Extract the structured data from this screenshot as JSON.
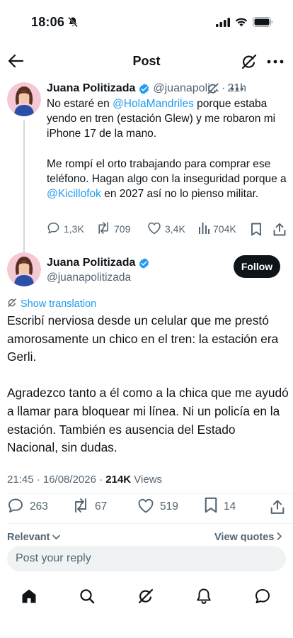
{
  "status_bar": {
    "time": "18:06",
    "icons": [
      "bell-slash-icon",
      "cellular-signal-icon",
      "wifi-icon",
      "battery-icon"
    ]
  },
  "header": {
    "title": "Post",
    "back_icon": "arrow-left-icon",
    "grok_icon": "grok-icon",
    "more_icon": "more-horizontal-icon"
  },
  "parent_tweet": {
    "author_name": "Juana Politizada",
    "handle": "@juanapoli...",
    "dot": "·",
    "time": "21h",
    "text_line1_a": "No estaré en ",
    "mention1": "@HolaMandriles",
    "text_line1_b": " porque estaba yendo en tren (estación Glew) y me robaron mi iPhone 17 de la mano.",
    "text_para2_a": "Me rompí el orto trabajando para comprar ese teléfono. Hagan algo con la inseguridad porque a ",
    "mention2": "@Kicillofok",
    "text_para2_b": " en 2027 así no lo pienso militar.",
    "replies": "1,3K",
    "reposts": "709",
    "likes": "3,4K",
    "views": "704K"
  },
  "main_tweet": {
    "author_name": "Juana Politizada",
    "handle": "@juanapolitizada",
    "follow_label": "Follow",
    "show_translation": "Show translation",
    "text_para1": "Escribí nerviosa desde un celular que me prestó amorosamente un chico en el tren: la estación era Gerli.",
    "text_para2": "Agradezco tanto a él como a la chica que me ayudó a llamar para bloquear mi línea. Ni un policía en la estación. También es ausencia del Estado Nacional, sin dudas.",
    "timestamp": "21:45 · 16/08/2026 · ",
    "views_count": "214K",
    "views_label": " Views",
    "replies": "263",
    "reposts": "67",
    "likes": "519",
    "bookmarks": "14"
  },
  "replies_section": {
    "sort_label": "Relevant",
    "view_quotes": "View quotes",
    "reply_placeholder": "Post your reply"
  },
  "bottom_nav": {
    "items": [
      "home-icon",
      "search-icon",
      "grok-icon",
      "notifications-icon",
      "messages-icon"
    ]
  },
  "colors": {
    "accent": "#1d9bf0",
    "text": "#0f1419",
    "secondary": "#536471",
    "follow_bg": "#0f1419"
  }
}
